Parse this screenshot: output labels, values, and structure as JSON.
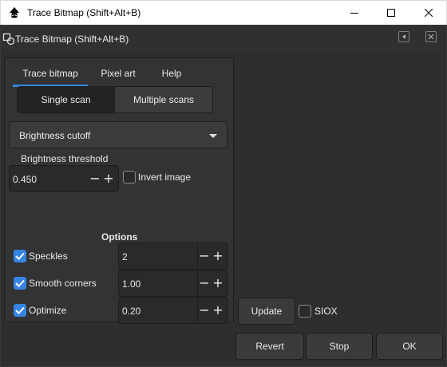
{
  "window": {
    "title": "Trace Bitmap (Shift+Alt+B)",
    "controls": [
      "minimize-icon",
      "maximize-icon",
      "close-icon"
    ]
  },
  "dialog": {
    "title": "Trace Bitmap (Shift+Alt+B)"
  },
  "tabs": [
    {
      "label": "Trace bitmap",
      "active": true
    },
    {
      "label": "Pixel art",
      "active": false
    },
    {
      "label": "Help",
      "active": false
    }
  ],
  "scan_mode": {
    "single": "Single scan",
    "multiple": "Multiple scans",
    "selected": "Single scan"
  },
  "mode_select": {
    "value": "Brightness cutoff"
  },
  "brightness": {
    "label": "Brightness threshold",
    "value": "0.450",
    "minus": "−",
    "plus": "+"
  },
  "invert": {
    "label": "Invert image",
    "checked": false
  },
  "options": {
    "heading": "Options",
    "speckles": {
      "label": "Speckles",
      "checked": true,
      "value": "2"
    },
    "smooth_corners": {
      "label": "Smooth corners",
      "checked": true,
      "value": "1.00"
    },
    "optimize": {
      "label": "Optimize",
      "checked": true,
      "value": "0.20"
    }
  },
  "preview": {
    "update_label": "Update",
    "siox_label": "SIOX",
    "siox_checked": false
  },
  "footer": {
    "revert_label": "Revert",
    "stop_label": "Stop",
    "ok_label": "OK"
  },
  "colors": {
    "accent": "#3584e4",
    "background": "#2e2e2e",
    "panel": "#333333"
  }
}
